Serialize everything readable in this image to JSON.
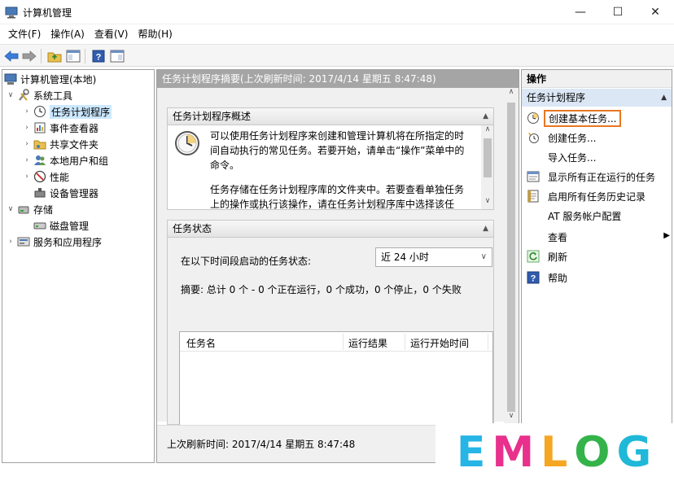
{
  "window": {
    "title": "计算机管理",
    "min": "—",
    "max": "☐",
    "close": "✕"
  },
  "menu": [
    "文件(F)",
    "操作(A)",
    "查看(V)",
    "帮助(H)"
  ],
  "tree": {
    "root": "计算机管理(本地)",
    "system_tools": "系统工具",
    "task_scheduler": "任务计划程序",
    "event_viewer": "事件查看器",
    "shared_folders": "共享文件夹",
    "local_users": "本地用户和组",
    "performance": "性能",
    "device_manager": "设备管理器",
    "storage": "存储",
    "disk_management": "磁盘管理",
    "services_apps": "服务和应用程序"
  },
  "center": {
    "header": "任务计划程序摘要(上次刷新时间: 2017/4/14 星期五 8:47:48)",
    "overview_title": "任务计划程序概述",
    "overview_p1": "可以使用任务计划程序来创建和管理计算机将在所指定的时间自动执行的常见任务。若要开始，请单击“操作”菜单中的命令。",
    "overview_p2": "任务存储在任务计划程序库的文件夹中。若要查看单独任务上的操作或执行该操作，请在任务计划程序库中选择该任",
    "status_title": "任务状态",
    "status_label": "在以下时间段启动的任务状态:",
    "status_range": "近 24 小时",
    "summary": "摘要: 总计 0 个 - 0 个正在运行，0 个成功，0 个停止，0 个失败",
    "col_name": "任务名",
    "col_result": "运行结果",
    "col_start": "运行开始时间",
    "footer": "上次刷新时间: 2017/4/14 星期五 8:47:48"
  },
  "actions": {
    "header": "操作",
    "section": "任务计划程序",
    "items": [
      "创建基本任务...",
      "创建任务...",
      "导入任务...",
      "显示所有正在运行的任务",
      "启用所有任务历史记录",
      "AT 服务帐户配置",
      "查看",
      "刷新",
      "帮助"
    ]
  },
  "watermark": {
    "letters": [
      "E",
      "M",
      "L",
      "O",
      "G"
    ],
    "colors": [
      "#27b5e6",
      "#e8308c",
      "#f5a623",
      "#34b34a",
      "#1fb8d8"
    ]
  }
}
